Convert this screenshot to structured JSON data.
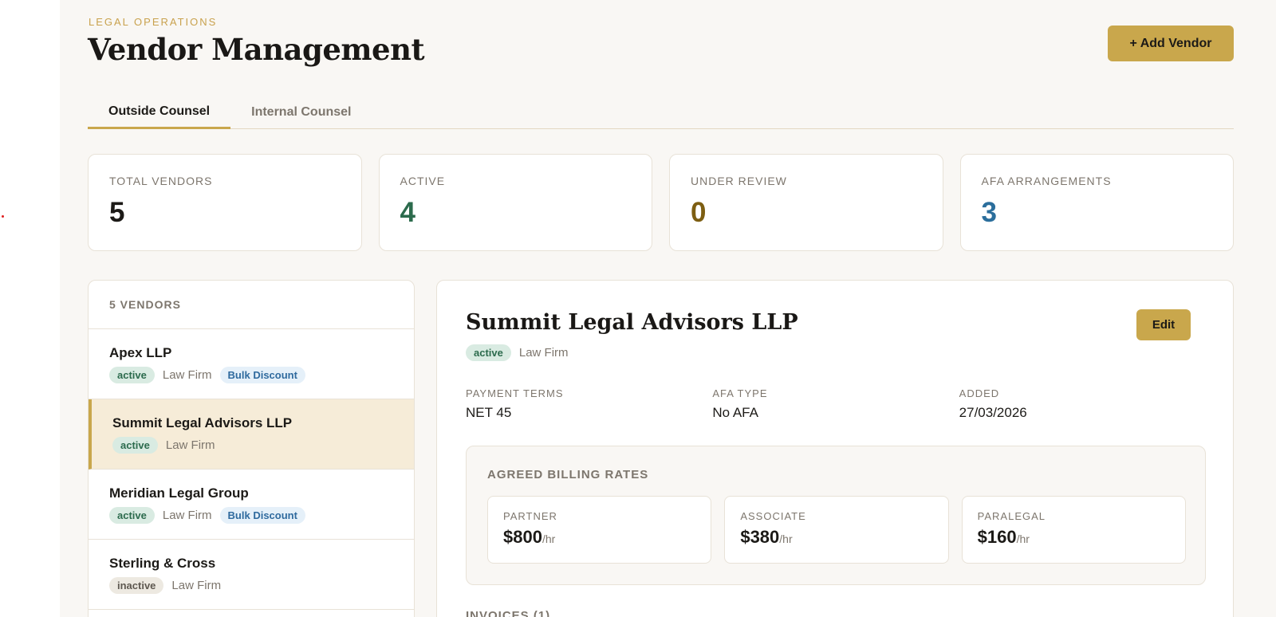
{
  "header": {
    "eyebrow": "LEGAL OPERATIONS",
    "title": "Vendor Management",
    "add_button_label": "+ Add Vendor"
  },
  "tabs": [
    {
      "label": "Outside Counsel",
      "active": true
    },
    {
      "label": "Internal Counsel",
      "active": false
    }
  ],
  "stats": [
    {
      "label": "TOTAL VENDORS",
      "value": "5",
      "color": "#1c1a17"
    },
    {
      "label": "ACTIVE",
      "value": "4",
      "color": "#2c6b4d"
    },
    {
      "label": "UNDER REVIEW",
      "value": "0",
      "color": "#7d5e12"
    },
    {
      "label": "AFA ARRANGEMENTS",
      "value": "3",
      "color": "#2b6e9c"
    }
  ],
  "vendor_list": {
    "header": "5 VENDORS",
    "items": [
      {
        "name": "Apex LLP",
        "status": "active",
        "type": "Law Firm",
        "tag": "Bulk Discount"
      },
      {
        "name": "Summit Legal Advisors LLP",
        "status": "active",
        "type": "Law Firm",
        "tag": ""
      },
      {
        "name": "Meridian Legal Group",
        "status": "active",
        "type": "Law Firm",
        "tag": "Bulk Discount"
      },
      {
        "name": "Sterling & Cross",
        "status": "inactive",
        "type": "Law Firm",
        "tag": ""
      }
    ]
  },
  "detail": {
    "name": "Summit Legal Advisors LLP",
    "edit_label": "Edit",
    "status": "active",
    "type": "Law Firm",
    "fields": [
      {
        "label": "PAYMENT TERMS",
        "value": "NET 45"
      },
      {
        "label": "AFA TYPE",
        "value": "No AFA"
      },
      {
        "label": "ADDED",
        "value": "27/03/2026"
      }
    ],
    "rates_title": "AGREED BILLING RATES",
    "rates": [
      {
        "label": "PARTNER",
        "value": "$800",
        "unit": "/hr"
      },
      {
        "label": "ASSOCIATE",
        "value": "$380",
        "unit": "/hr"
      },
      {
        "label": "PARALEGAL",
        "value": "$160",
        "unit": "/hr"
      }
    ],
    "invoices_title": "INVOICES (1)"
  }
}
